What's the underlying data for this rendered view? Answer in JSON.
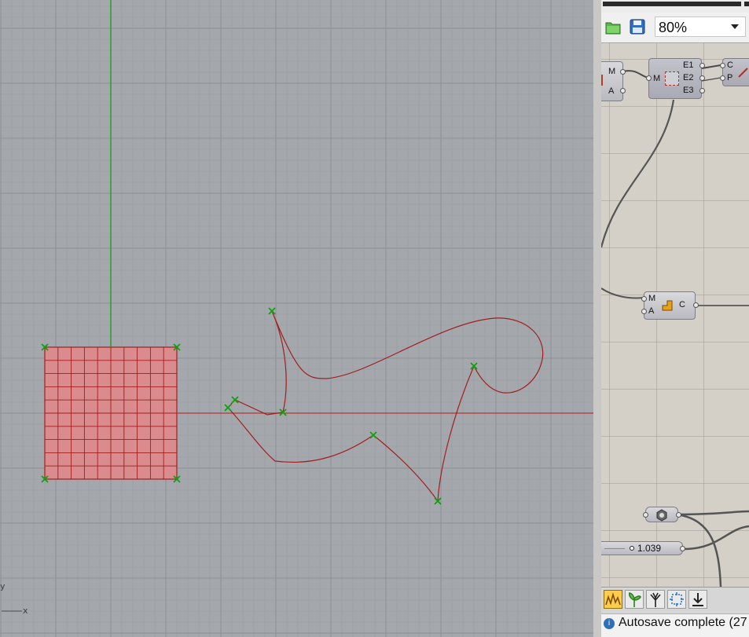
{
  "viewport": {
    "background": "#a4a8ad",
    "axes": {
      "y_label": "y",
      "x_label": "x"
    },
    "colors": {
      "minor_grid": "#989ca1",
      "major_grid": "#8d9196",
      "x_axis": "#b33535",
      "y_axis": "#2f9a2f",
      "curve": "#a11e1e",
      "point": "#10a010",
      "surface_fill": "#d98b8d"
    }
  },
  "grasshopper": {
    "toolbar": {
      "open_icon": "open-folder-icon",
      "save_icon": "save-disk-icon",
      "zoom_value": "80%"
    },
    "components": [
      {
        "name": "input-box",
        "inputs": [
          "M",
          "A"
        ]
      },
      {
        "name": "explode",
        "inputs": [
          "M"
        ],
        "outputs": [
          "E1",
          "E2",
          "E3"
        ]
      },
      {
        "name": "partial",
        "inputs": [
          "C",
          "P"
        ]
      },
      {
        "name": "area",
        "inputs": [
          "M",
          "A"
        ],
        "outputs": [
          "C"
        ]
      },
      {
        "name": "param",
        "icon": "hexagon-nut-icon"
      }
    ],
    "slider": {
      "value": "1.039"
    },
    "footer_icons": [
      "sound-wave-icon",
      "sprout-icon",
      "tree-icon",
      "transform-icon",
      "download-icon"
    ],
    "status": {
      "text": "Autosave complete (27"
    }
  }
}
